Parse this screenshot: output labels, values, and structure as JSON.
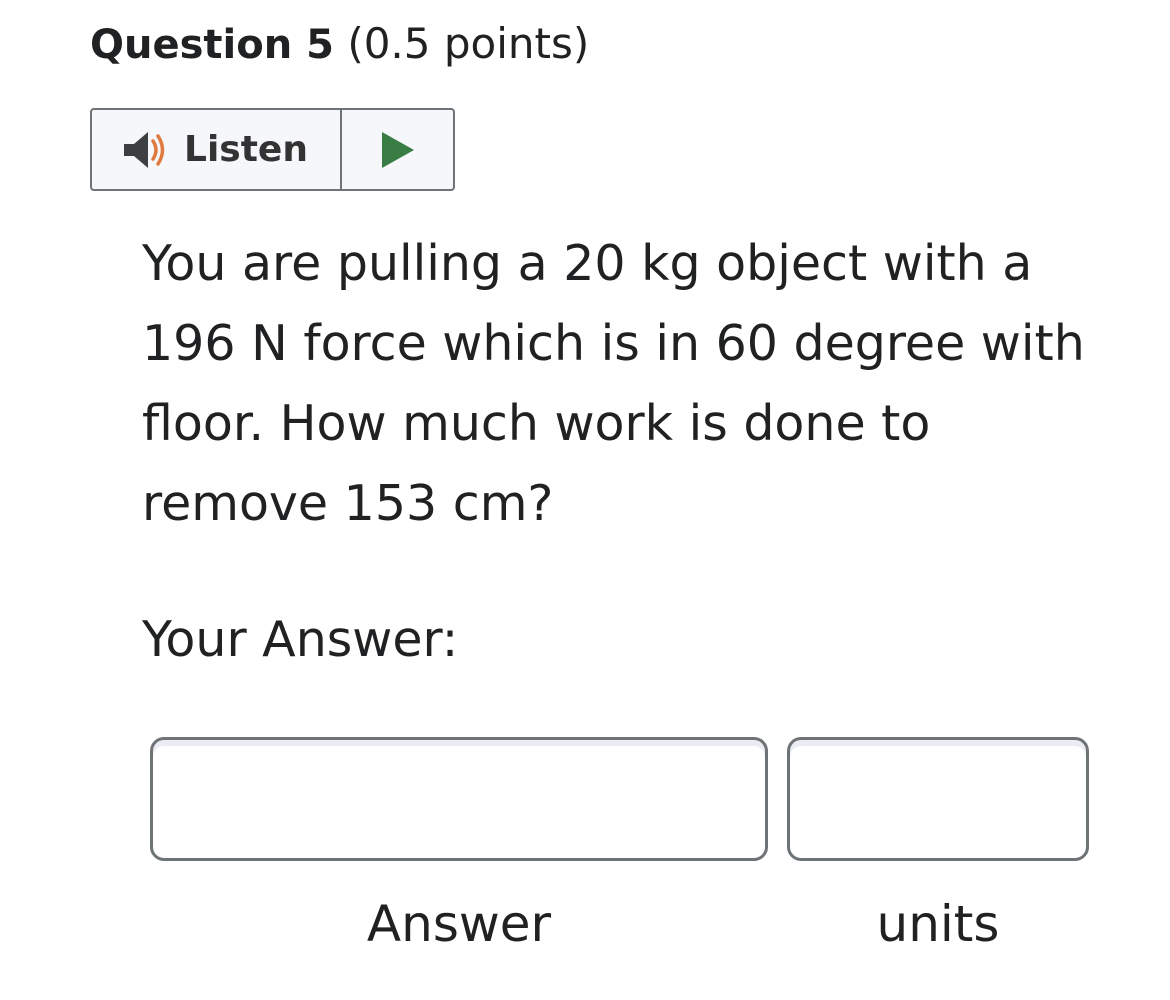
{
  "question": {
    "number_label": "Question 5",
    "points_label": "(0.5 points)",
    "text": "You are pulling a 20 kg object with a 196 N force which is in 60 degree with floor. How much work is done to remove 153 cm?"
  },
  "listen_widget": {
    "label": "Listen",
    "speaker_icon": "speaker-icon",
    "play_icon": "play-icon",
    "play_color": "#3a7d44",
    "speaker_wave_color": "#e07a3e"
  },
  "answer": {
    "prompt": "Your Answer:",
    "answer_field": {
      "value": "",
      "label": "Answer"
    },
    "units_field": {
      "value": "",
      "label": "units"
    }
  }
}
